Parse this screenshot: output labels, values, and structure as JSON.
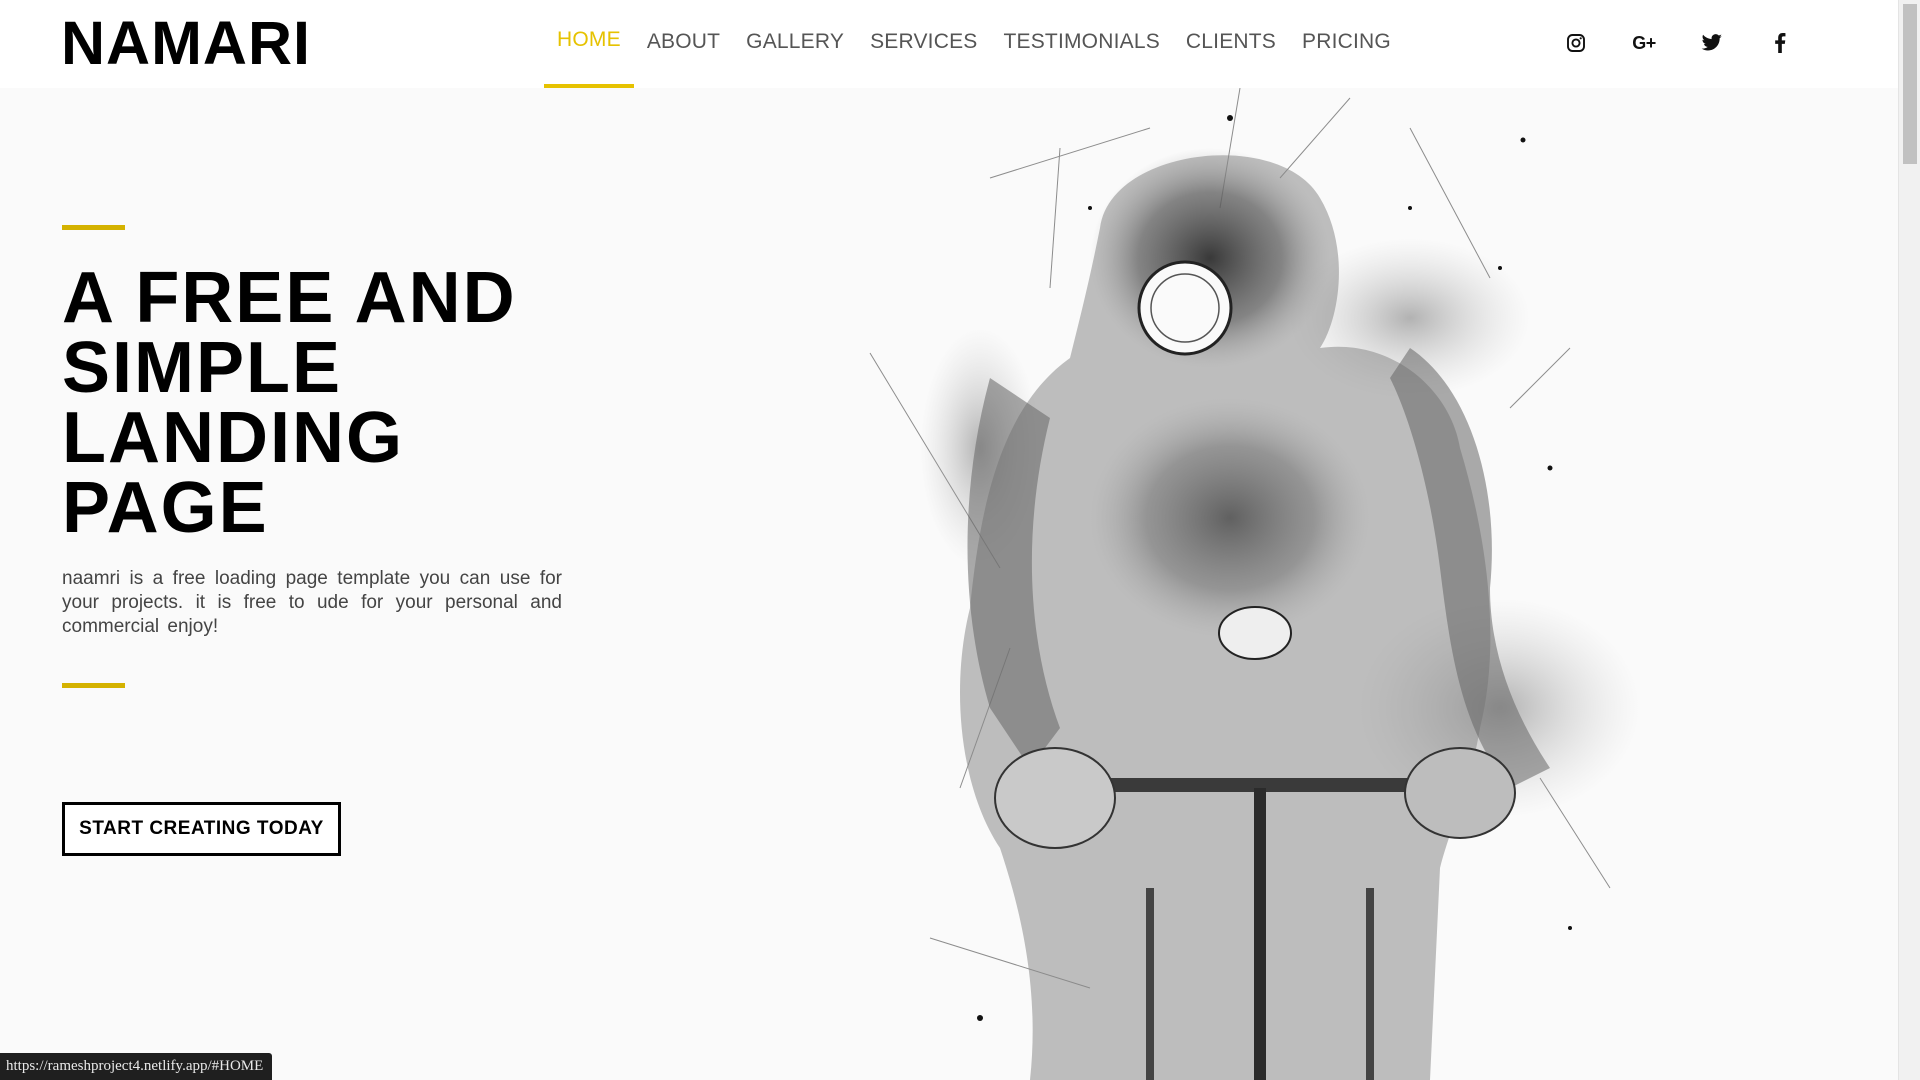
{
  "brand": {
    "logo_text": "NAMARI",
    "accent_color": "#e6c200"
  },
  "nav": {
    "items": [
      {
        "label": "HOME",
        "active": true
      },
      {
        "label": "ABOUT",
        "active": false
      },
      {
        "label": "GALLERY",
        "active": false
      },
      {
        "label": "SERVICES",
        "active": false
      },
      {
        "label": "TESTIMONIALS",
        "active": false
      },
      {
        "label": "CLIENTS",
        "active": false
      },
      {
        "label": "PRICING",
        "active": false
      }
    ]
  },
  "socials": [
    {
      "icon": "instagram-icon"
    },
    {
      "icon": "google-plus-icon",
      "text": "G+"
    },
    {
      "icon": "twitter-icon"
    },
    {
      "icon": "facebook-icon"
    }
  ],
  "hero": {
    "title_lines": [
      "A FREE AND",
      "SIMPLE",
      "LANDING",
      "PAGE"
    ],
    "description": "naamri is a free loading page template you can use for your projects. it is free to ude for your personal and commercial enjoy!",
    "cta_label": "START CREATING TODAY",
    "illustration": "sketch-cyclist-illustration"
  },
  "status_bar": {
    "url": "https://rameshproject4.netlify.app/#HOME"
  }
}
